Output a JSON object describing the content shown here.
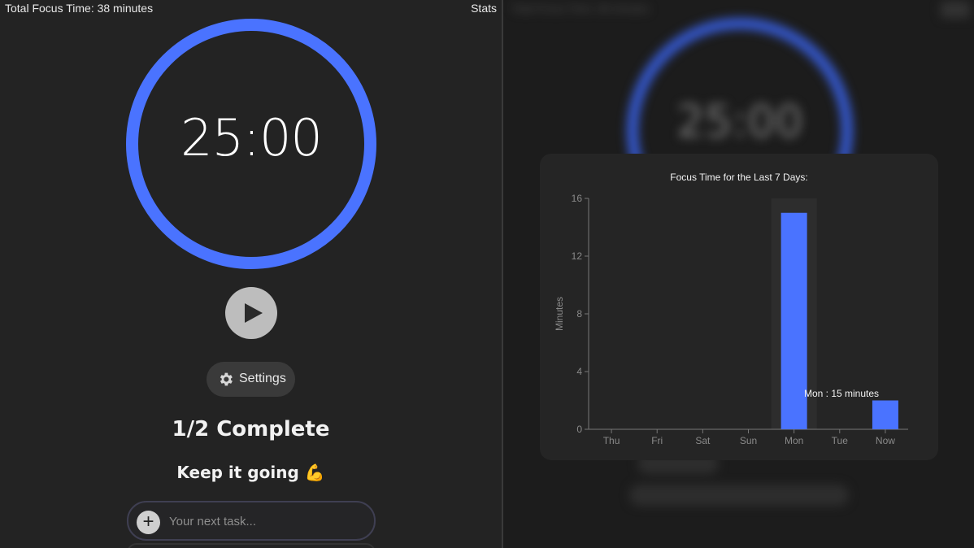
{
  "header": {
    "total_focus": "Total Focus Time: 38 minutes",
    "stats_label": "Stats"
  },
  "timer": {
    "display": "25:00"
  },
  "controls": {
    "settings_label": "Settings"
  },
  "progress": {
    "complete_text": "1/2 Complete",
    "encouragement": "Keep it going 💪"
  },
  "task_input": {
    "placeholder": "Your next task..."
  },
  "stats_modal": {
    "title": "Focus Time for the Last 7 Days:",
    "tooltip": "Mon : 15 minutes"
  },
  "colors": {
    "accent": "#4a73ff",
    "background": "#232323"
  },
  "chart_data": {
    "type": "bar",
    "categories": [
      "Thu",
      "Fri",
      "Sat",
      "Sun",
      "Mon",
      "Tue",
      "Now"
    ],
    "values": [
      0,
      0,
      0,
      0,
      15,
      0,
      2
    ],
    "ylabel": "Minutes",
    "ylim": [
      0,
      16
    ],
    "yticks": [
      0,
      4,
      8,
      12,
      16
    ],
    "highlighted_category": "Mon",
    "grid": false,
    "bar_color": "#4a73ff"
  }
}
